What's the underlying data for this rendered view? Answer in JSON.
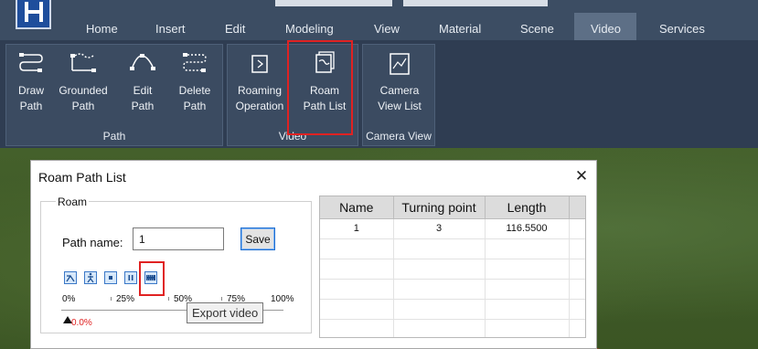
{
  "menubar": {
    "tabs": [
      {
        "label": "Home"
      },
      {
        "label": "Insert"
      },
      {
        "label": "Edit"
      },
      {
        "label": "Modeling"
      },
      {
        "label": "View"
      },
      {
        "label": "Material"
      },
      {
        "label": "Scene"
      },
      {
        "label": "Video",
        "active": true
      },
      {
        "label": "Services"
      }
    ]
  },
  "ribbon": {
    "groups": [
      {
        "label": "Path",
        "buttons": [
          {
            "label": "Draw\nPath",
            "icon": "draw-path-icon"
          },
          {
            "label": "Grounded\nPath",
            "icon": "grounded-path-icon"
          },
          {
            "label": "Edit\nPath",
            "icon": "edit-path-icon"
          },
          {
            "label": "Delete\nPath",
            "icon": "delete-path-icon"
          }
        ]
      },
      {
        "label": "Video",
        "buttons": [
          {
            "label": "Roaming\nOperation",
            "icon": "roaming-operation-icon"
          },
          {
            "label": "Roam\nPath List",
            "icon": "roam-path-list-icon"
          }
        ]
      },
      {
        "label": "Camera View",
        "buttons": [
          {
            "label": "Camera\nView List",
            "icon": "camera-view-list-icon"
          }
        ]
      }
    ]
  },
  "dialog": {
    "title": "Roam Path List",
    "close_glyph": "✕",
    "roam_group_label": "Roam",
    "path_name_label": "Path name:",
    "path_name_value": "1",
    "save_label": "Save",
    "controls": [
      {
        "icon": "roam-view-icon"
      },
      {
        "icon": "walk-icon"
      },
      {
        "icon": "stop-icon"
      },
      {
        "icon": "pause-icon"
      },
      {
        "icon": "export-video-icon"
      }
    ],
    "progress_ticks": [
      "0%",
      "25%",
      "50%",
      "75%",
      "100%"
    ],
    "progress_value": "0.0%",
    "progress_fraction": 0.0,
    "tooltip": "Export video",
    "table": {
      "columns": [
        "Name",
        "Turning point",
        "Length"
      ],
      "rows": [
        [
          "1",
          "3",
          "116.5500"
        ]
      ]
    }
  },
  "colors": {
    "menubar": "#3c4d63",
    "ribbon": "#2f3d52",
    "active_tab": "#5d6f86",
    "highlight": "#e02222",
    "terrain": "#44602b"
  }
}
